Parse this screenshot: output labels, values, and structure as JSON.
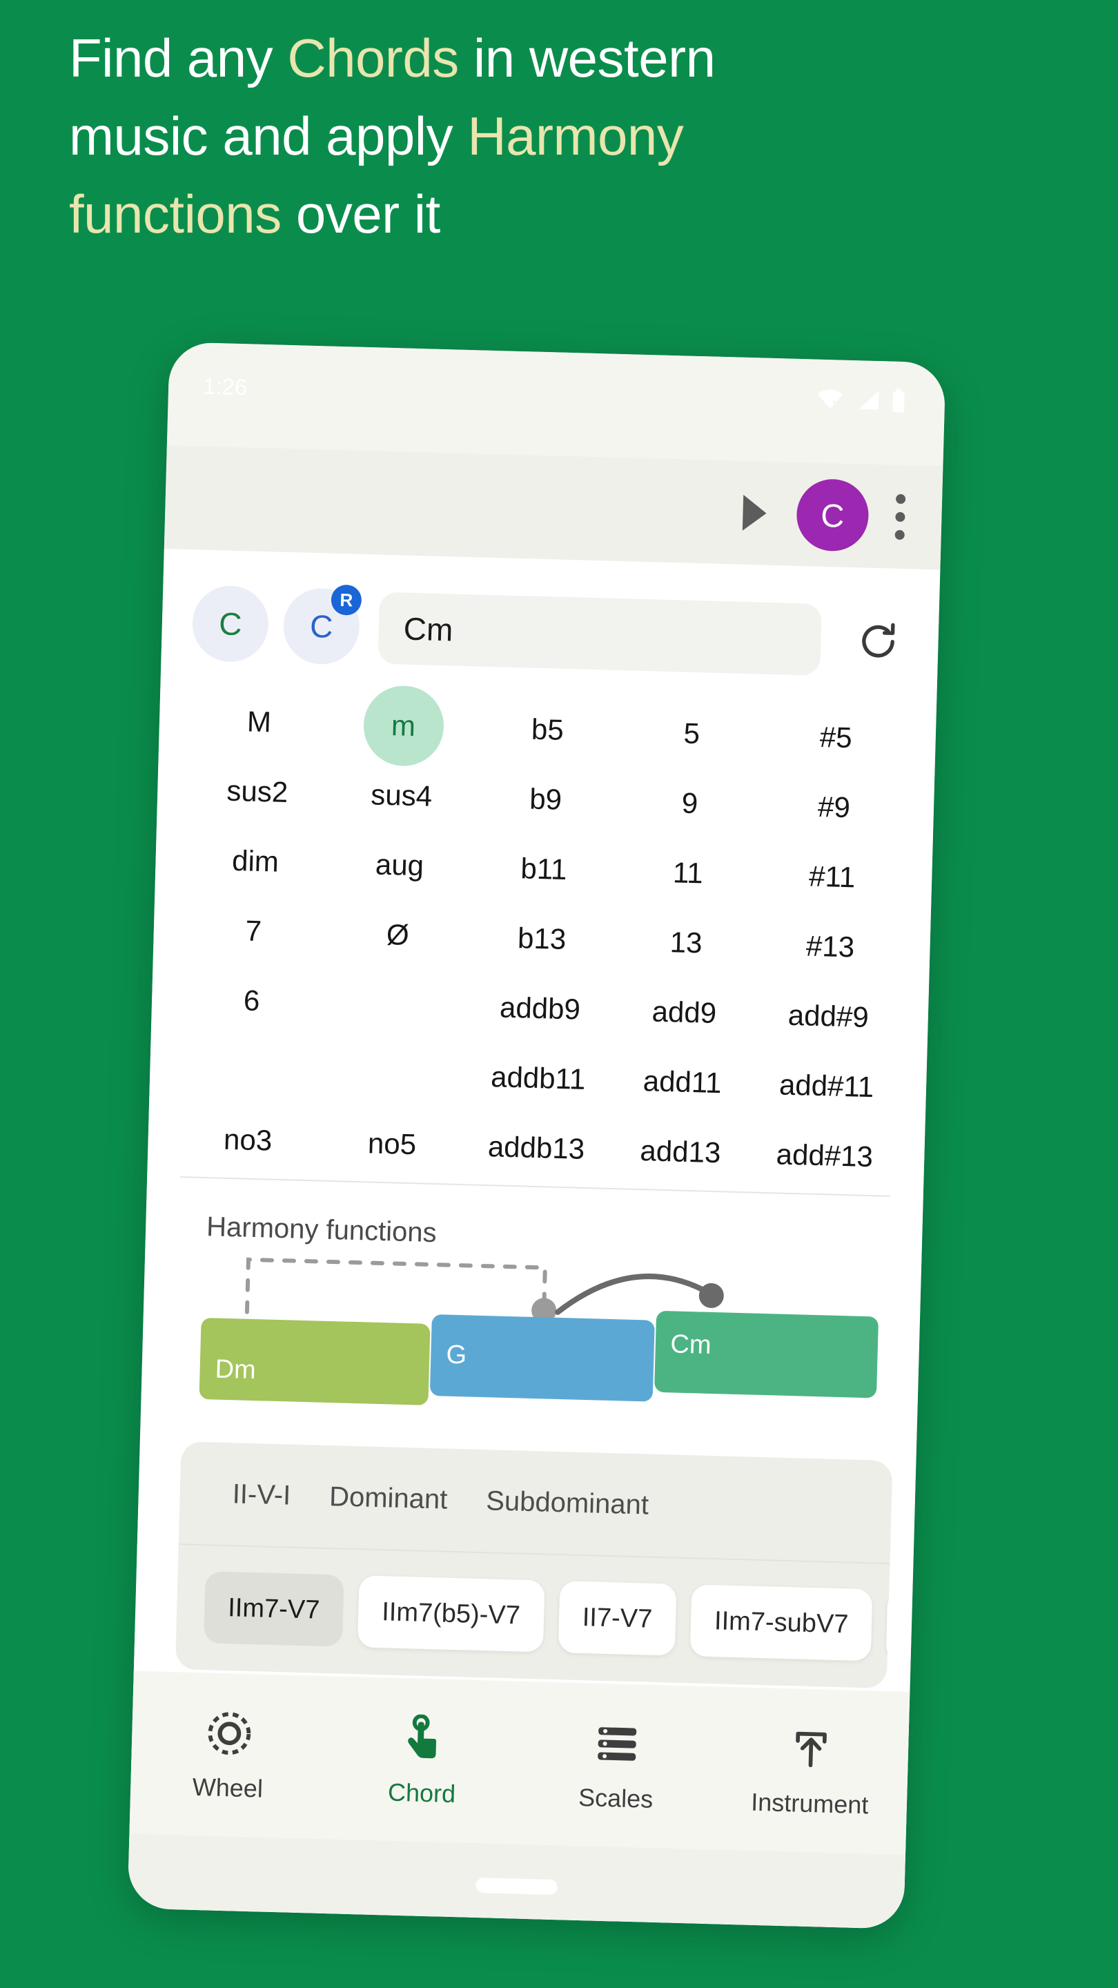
{
  "headline": {
    "line1_pre": "Find any ",
    "line1_hl": "Chords",
    "line1_post": " in western",
    "line2_pre": "music and apply ",
    "line2_hl": "Harmony",
    "line3_hl": "functions",
    "line3_post": " over it"
  },
  "colors": {
    "background_green": "#0a8d4c",
    "headline_white": "#ffffff",
    "headline_accent": "#e9e5ae",
    "avatar_purple": "#9c27b0",
    "selected_chip_bg": "#b9e5cd",
    "selected_chip_text": "#157a45",
    "bar_dm": "#a4c45c",
    "bar_g": "#5ca8d4",
    "bar_cm": "#4cb483",
    "active_nav": "#137a3e"
  },
  "statusbar": {
    "clock": "1:26",
    "icons": [
      "wifi-off-icon",
      "signal-icon",
      "battery-icon"
    ]
  },
  "appbar": {
    "play_icon": "play-icon",
    "avatar_letter": "C",
    "overflow_icon": "overflow-menu-icon"
  },
  "search": {
    "root_chip_1": "C",
    "root_chip_2": "C",
    "root_badge": "R",
    "value": "Cm",
    "placeholder": "Cm",
    "refresh_icon": "refresh-icon"
  },
  "chord_grid": {
    "selected": "m",
    "rows": [
      [
        "M",
        "m",
        "b5",
        "5",
        "#5"
      ],
      [
        "sus2",
        "sus4",
        "b9",
        "9",
        "#9"
      ],
      [
        "dim",
        "aug",
        "b11",
        "11",
        "#11"
      ],
      [
        "7",
        "Ø",
        "b13",
        "13",
        "#13"
      ],
      [
        "6",
        "",
        "addb9",
        "add9",
        "add#9"
      ],
      [
        "",
        "",
        "addb11",
        "add11",
        "add#11"
      ],
      [
        "no3",
        "no5",
        "addb13",
        "add13",
        "add#13"
      ]
    ]
  },
  "harmony": {
    "title": "Harmony functions",
    "bars": [
      {
        "label": "Dm"
      },
      {
        "label": "G"
      },
      {
        "label": "Cm"
      }
    ]
  },
  "functions_card": {
    "tabs": [
      {
        "label": "II-V-I",
        "active": true
      },
      {
        "label": "Dominant",
        "active": false
      },
      {
        "label": "Subdominant",
        "active": false
      }
    ],
    "chips": [
      {
        "label": "IIm7-V7",
        "selected": true
      },
      {
        "label": "IIm7(b5)-V7",
        "selected": false
      },
      {
        "label": "II7-V7",
        "selected": false
      },
      {
        "label": "IIm7-subV7",
        "selected": false
      }
    ]
  },
  "bottom_nav": [
    {
      "label": "Wheel",
      "icon": "wheel-icon",
      "active": false
    },
    {
      "label": "Chord",
      "icon": "touch-hand-icon",
      "active": true
    },
    {
      "label": "Scales",
      "icon": "list-icon",
      "active": false
    },
    {
      "label": "Instrument",
      "icon": "upload-icon",
      "active": false
    }
  ]
}
